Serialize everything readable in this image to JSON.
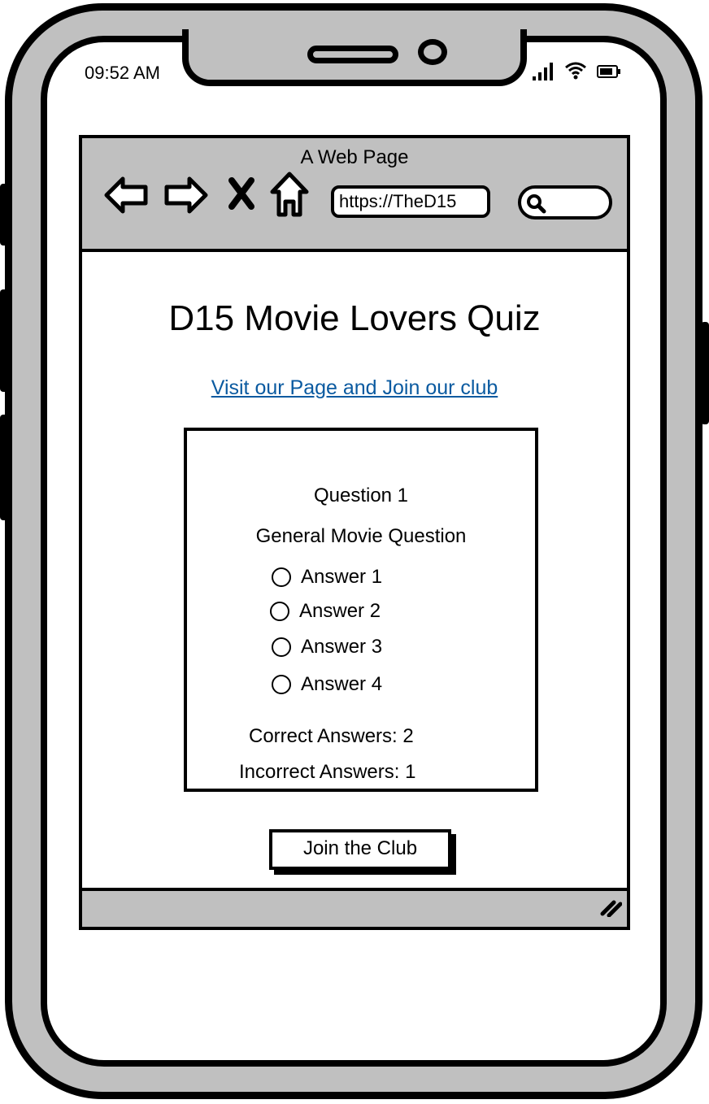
{
  "status_bar": {
    "time": "09:52 AM"
  },
  "browser": {
    "title": "A Web Page",
    "url": "https://TheD15",
    "search_placeholder": ""
  },
  "page": {
    "title": "D15 Movie Lovers Quiz",
    "link_text": "Visit our Page and Join our club",
    "quiz": {
      "question_heading": "Question 1",
      "question_text": "General Movie Question",
      "answers": [
        "Answer 1",
        "Answer 2",
        "Answer 3",
        "Answer 4"
      ],
      "correct_text": "Correct Answers: 2",
      "incorrect_text": "Incorrect Answers: 1"
    },
    "join_button_label": "Join the Club"
  },
  "colors": {
    "frame_gray": "#c0c0c0",
    "link_blue": "#0a5aa0"
  }
}
